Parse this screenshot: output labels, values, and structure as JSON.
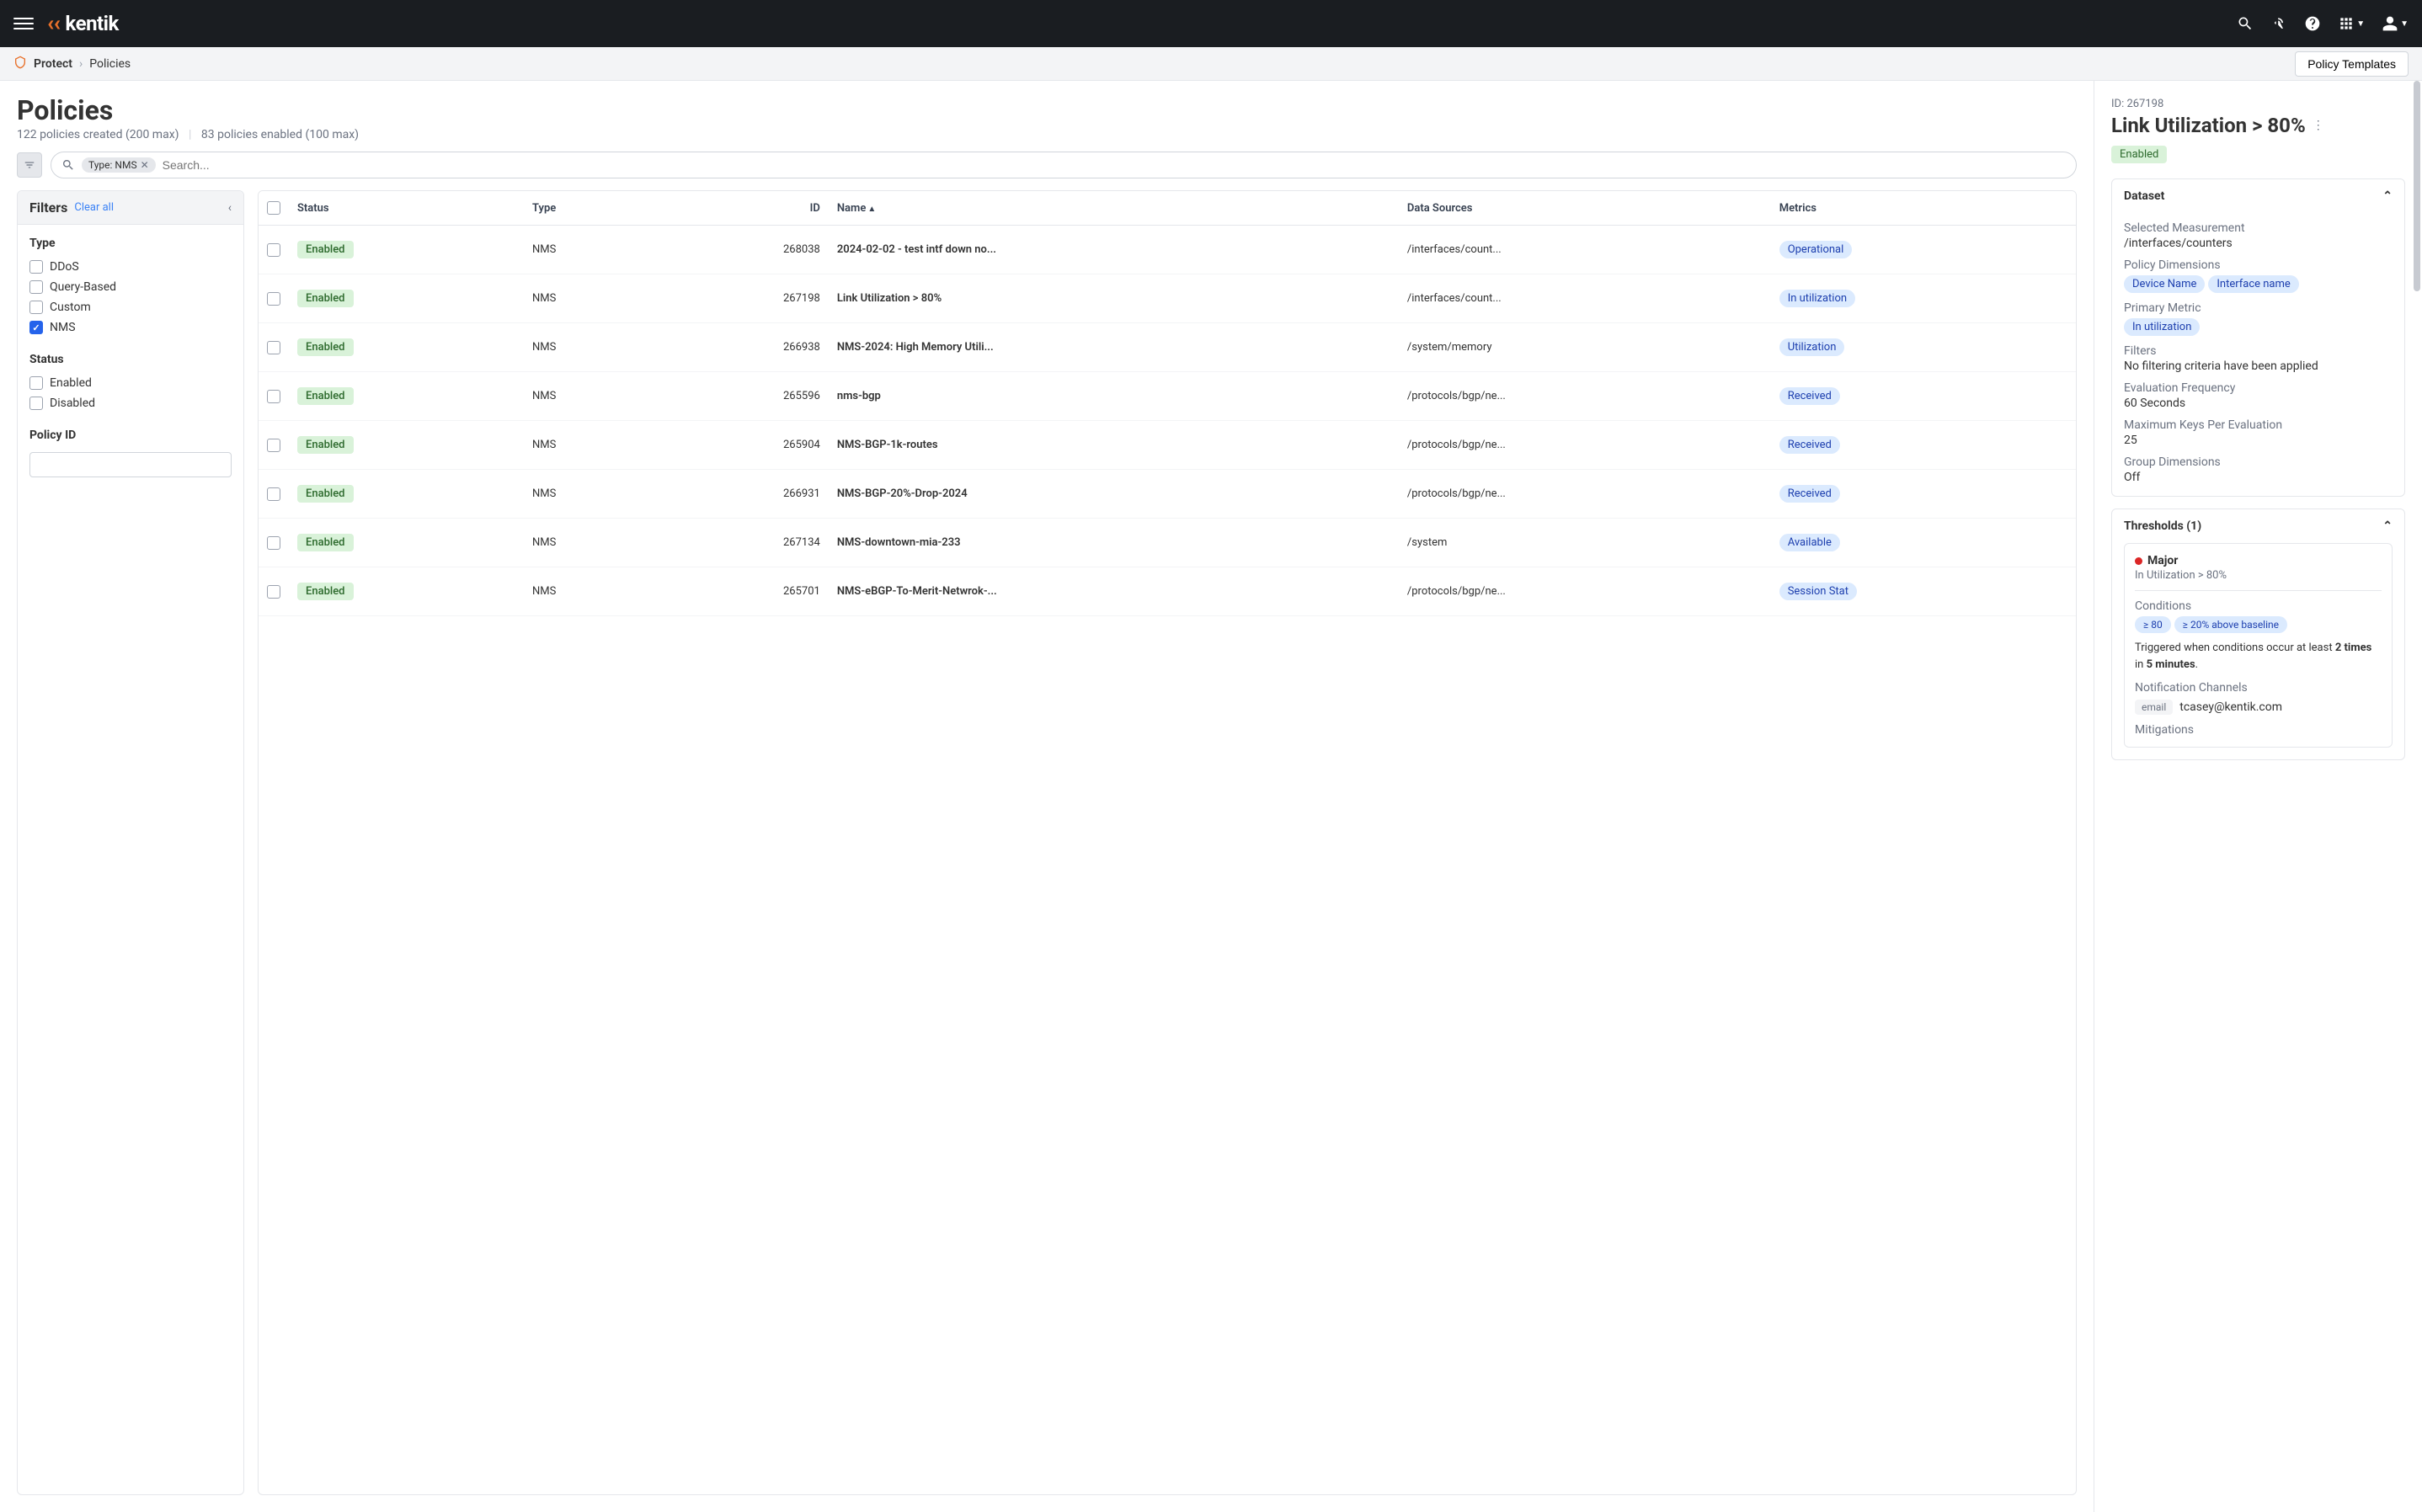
{
  "topbar": {
    "brand": "kentik"
  },
  "breadcrumb": {
    "root": "Protect",
    "current": "Policies",
    "templates_btn": "Policy Templates"
  },
  "header": {
    "title": "Policies",
    "created": "122 policies created (200 max)",
    "enabled": "83 policies enabled (100 max)"
  },
  "search": {
    "tag": "Type: NMS",
    "placeholder": "Search..."
  },
  "filters": {
    "title": "Filters",
    "clear": "Clear all",
    "groups": {
      "type": {
        "title": "Type",
        "items": [
          {
            "label": "DDoS",
            "checked": false
          },
          {
            "label": "Query-Based",
            "checked": false
          },
          {
            "label": "Custom",
            "checked": false
          },
          {
            "label": "NMS",
            "checked": true
          }
        ]
      },
      "status": {
        "title": "Status",
        "items": [
          {
            "label": "Enabled",
            "checked": false
          },
          {
            "label": "Disabled",
            "checked": false
          }
        ]
      },
      "policy_id": {
        "title": "Policy ID"
      }
    }
  },
  "table": {
    "headers": {
      "status": "Status",
      "type": "Type",
      "id": "ID",
      "name": "Name",
      "data_sources": "Data Sources",
      "metrics": "Metrics"
    },
    "rows": [
      {
        "status": "Enabled",
        "type": "NMS",
        "id": "268038",
        "name": "2024-02-02 - test intf down no...",
        "ds": "/interfaces/count...",
        "metric": "Operational"
      },
      {
        "status": "Enabled",
        "type": "NMS",
        "id": "267198",
        "name": "Link Utilization > 80%",
        "ds": "/interfaces/count...",
        "metric": "In utilization"
      },
      {
        "status": "Enabled",
        "type": "NMS",
        "id": "266938",
        "name": "NMS-2024: High Memory Utili...",
        "ds": "/system/memory",
        "metric": "Utilization"
      },
      {
        "status": "Enabled",
        "type": "NMS",
        "id": "265596",
        "name": "nms-bgp",
        "ds": "/protocols/bgp/ne...",
        "metric": "Received"
      },
      {
        "status": "Enabled",
        "type": "NMS",
        "id": "265904",
        "name": "NMS-BGP-1k-routes",
        "ds": "/protocols/bgp/ne...",
        "metric": "Received"
      },
      {
        "status": "Enabled",
        "type": "NMS",
        "id": "266931",
        "name": "NMS-BGP-20%-Drop-2024",
        "ds": "/protocols/bgp/ne...",
        "metric": "Received"
      },
      {
        "status": "Enabled",
        "type": "NMS",
        "id": "267134",
        "name": "NMS-downtown-mia-233",
        "ds": "/system",
        "metric": "Available"
      },
      {
        "status": "Enabled",
        "type": "NMS",
        "id": "265701",
        "name": "NMS-eBGP-To-Merit-Netwrok-...",
        "ds": "/protocols/bgp/ne...",
        "metric": "Session Stat"
      }
    ]
  },
  "detail": {
    "id_label": "ID: 267198",
    "title": "Link Utilization > 80%",
    "status": "Enabled",
    "dataset": {
      "title": "Dataset",
      "selected_measurement_label": "Selected Measurement",
      "selected_measurement_value": "/interfaces/counters",
      "policy_dimensions_label": "Policy Dimensions",
      "policy_dimensions": [
        "Device Name",
        "Interface name"
      ],
      "primary_metric_label": "Primary Metric",
      "primary_metric": "In utilization",
      "filters_label": "Filters",
      "filters_value": "No filtering criteria have been applied",
      "eval_freq_label": "Evaluation Frequency",
      "eval_freq_value": "60 Seconds",
      "max_keys_label": "Maximum Keys Per Evaluation",
      "max_keys_value": "25",
      "group_dims_label": "Group Dimensions",
      "group_dims_value": "Off"
    },
    "thresholds": {
      "title": "Thresholds (1)",
      "severity": "Major",
      "subtitle": "In Utilization > 80%",
      "conditions_label": "Conditions",
      "conditions": [
        "≥ 80",
        "≥ 20% above baseline"
      ],
      "trigger_prefix": "Triggered when conditions occur at least ",
      "trigger_bold1": "2 times",
      "trigger_mid": " in ",
      "trigger_bold2": "5 minutes",
      "trigger_suffix": ".",
      "notif_label": "Notification Channels",
      "notif_chip": "email",
      "notif_value": "tcasey@kentik.com",
      "mitigations_label": "Mitigations"
    }
  }
}
